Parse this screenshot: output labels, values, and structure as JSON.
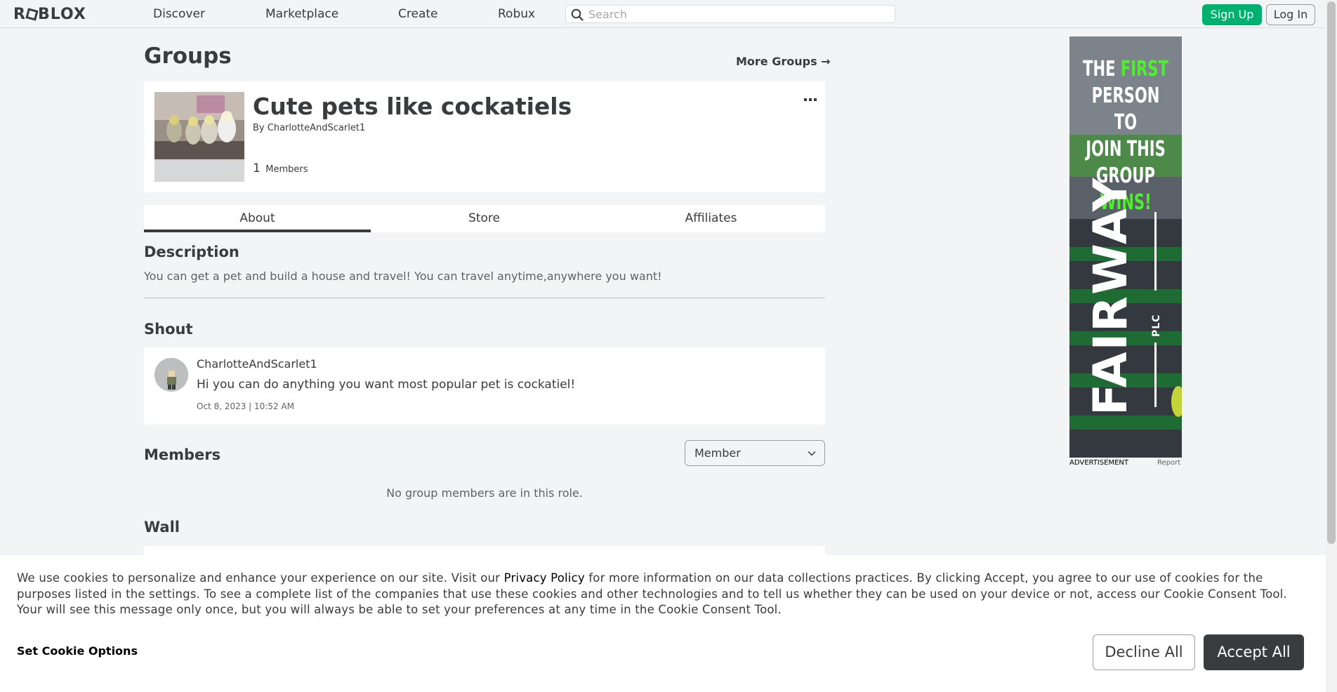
{
  "nav": {
    "logo_text": "ROBLOX",
    "links": [
      "Discover",
      "Marketplace",
      "Create",
      "Robux"
    ],
    "search_placeholder": "Search",
    "signup_label": "Sign Up",
    "login_label": "Log In"
  },
  "page": {
    "title": "Groups",
    "more_groups_label": "More Groups →"
  },
  "group": {
    "name": "Cute pets like cockatiels",
    "by_prefix": "By",
    "owner": "CharlotteAndScarlet1",
    "member_count": "1",
    "members_label": "Members",
    "more_icon": "•••"
  },
  "tabs": [
    "About",
    "Store",
    "Affiliates"
  ],
  "description": {
    "title": "Description",
    "text": "You can get a pet and build a house and travel! You can travel anytime,anywhere you want!"
  },
  "shout": {
    "title": "Shout",
    "user": "CharlotteAndScarlet1",
    "message": "Hi you can do anything you want most popular pet is cockatiel!",
    "time": "Oct 8, 2023 | 10:52 AM"
  },
  "members": {
    "title": "Members",
    "role_selected": "Member",
    "empty_text": "No group members are in this role."
  },
  "wall": {
    "title": "Wall"
  },
  "ad": {
    "headline_1": "THE ",
    "headline_green_1": "FIRST",
    "headline_2": "PERSON TO",
    "headline_3": "JOIN THIS",
    "headline_4": "GROUP",
    "headline_green_2": "WINS!",
    "brand": "FAIRWAY",
    "brand_suffix": "PLC",
    "label": "ADVERTISEMENT",
    "report": "Report"
  },
  "cookie": {
    "text_before": "We use cookies to personalize and enhance your experience on our site. Visit our ",
    "privacy_link": "Privacy Policy",
    "text_after": " for more information on our data collections practices. By clicking Accept, you agree to our use of cookies for the purposes listed in the settings. To see a complete list of the companies that use these cookies and other technologies and to tell us whether they can be used on your device or not, access our Cookie Consent Tool. Your will see this message only once, but you will always be able to set your preferences at any time in the Cookie Consent Tool.",
    "options_label": "Set Cookie Options",
    "decline_label": "Decline All",
    "accept_label": "Accept All"
  },
  "colors": {
    "signup_green": "#00b06f",
    "ad_green": "#4ef02e",
    "text_dark": "#393b3d"
  }
}
